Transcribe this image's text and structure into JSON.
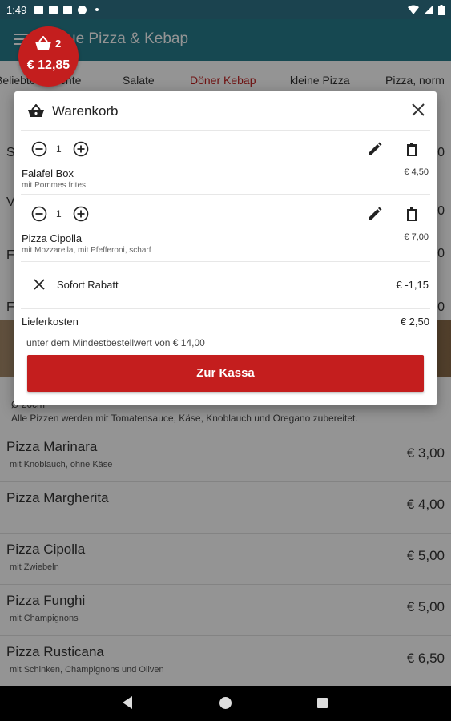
{
  "status_bar": {
    "time": "1:49"
  },
  "app_bar": {
    "title": "...ue Pizza & Kebap",
    "title_visible": "ue Pizza & Kebap"
  },
  "tabs": [
    {
      "label": "Beliebte Gerichte"
    },
    {
      "label": "Salate"
    },
    {
      "label": "Döner Kebap",
      "active": true
    },
    {
      "label": "kleine Pizza"
    },
    {
      "label": "Pizza, norm"
    }
  ],
  "cart_badge": {
    "count": "2",
    "total": "€ 12,85"
  },
  "background": {
    "partial_rows": [
      {
        "left": "S",
        "right": "0"
      },
      {
        "left": "V",
        "right": "0"
      },
      {
        "left": "F",
        "right": "0"
      },
      {
        "left": "F",
        "right": "0"
      }
    ],
    "section": {
      "size": "Ø 26cm",
      "note": "Alle Pizzen werden mit Tomatensauce, Käse, Knoblauch und Oregano zubereitet."
    },
    "items": [
      {
        "name": "Pizza Marinara",
        "desc": "mit Knoblauch, ohne Käse",
        "price": "€ 3,00"
      },
      {
        "name": "Pizza Margherita",
        "desc": "",
        "price": "€ 4,00"
      },
      {
        "name": "Pizza Cipolla",
        "desc": "mit Zwiebeln",
        "price": "€ 5,00"
      },
      {
        "name": "Pizza Funghi",
        "desc": "mit Champignons",
        "price": "€ 5,00"
      },
      {
        "name": "Pizza Rusticana",
        "desc": "mit Schinken, Champignons und Oliven",
        "price": "€ 6,50"
      }
    ]
  },
  "cart": {
    "title": "Warenkorb",
    "items": [
      {
        "qty": "1",
        "name": "Falafel Box",
        "desc": "mit Pommes frites",
        "price": "€ 4,50"
      },
      {
        "qty": "1",
        "name": "Pizza Cipolla",
        "desc": "mit Mozzarella, mit Pfefferoni, scharf",
        "price": "€ 7,00"
      }
    ],
    "discount": {
      "label": "Sofort Rabatt",
      "value": "€ -1,15"
    },
    "delivery": {
      "label": "Lieferkosten",
      "value": "€ 2,50"
    },
    "minimum_note": "unter dem Mindestbestellwert von € 14,00",
    "checkout_label": "Zur Kassa"
  },
  "colors": {
    "primary": "#277c8c",
    "accent": "#c41e1e",
    "status_bar": "#1b434f"
  }
}
